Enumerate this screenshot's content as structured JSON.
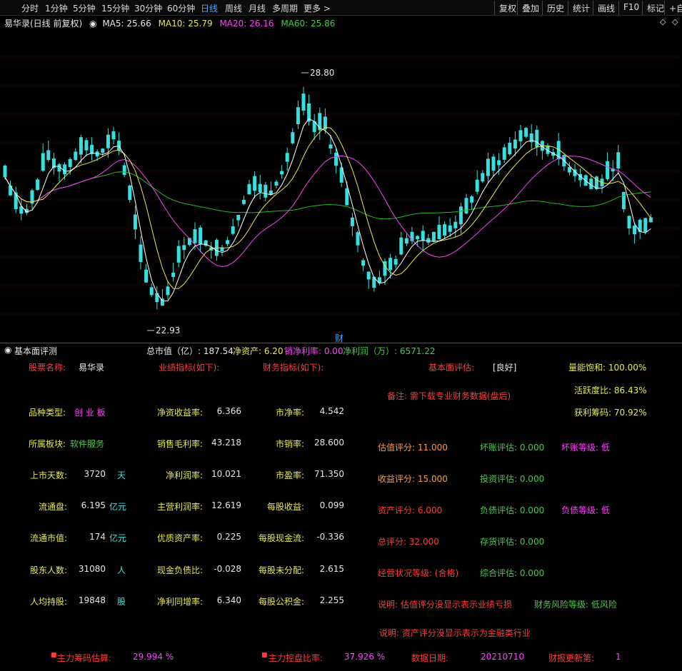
{
  "toolbar": {
    "periods": [
      "分时",
      "1分钟",
      "5分钟",
      "15分钟",
      "30分钟",
      "60分钟",
      "日线",
      "周线",
      "月线",
      "多周期",
      "更多 >"
    ],
    "active_period": "日线",
    "buttons": [
      "复权",
      "叠加",
      "历史",
      "统计",
      "画线",
      "F10",
      "标记",
      "+自"
    ]
  },
  "legend": {
    "title": "易华录(日线 前复权)",
    "ma5": "MA5: 25.66",
    "ma10": "MA10: 25.79",
    "ma20": "MA20: 26.16",
    "ma60": "MA60: 25.86"
  },
  "chart": {
    "high_label": "28.80",
    "low_label": "22.93",
    "event_marker": "财",
    "colors": {
      "up": "#ff3b3b",
      "down": "#36e0e0",
      "ma5": "#ffffff",
      "ma10": "#e8e84a",
      "ma20": "#ff40ff",
      "ma60": "#22bb22"
    }
  },
  "fundamentals_bar": {
    "title": "基本面评测",
    "market_cap": "总市值（亿）: 187.54",
    "net_assets": "净资产: 6.20",
    "net_margin": "销净利率: 0.00",
    "net_profit": "净利润（万）: 6571.22"
  },
  "panel": {
    "stock_name_label": "股票名称:",
    "stock_name": "易华录",
    "perf_header": "业绩指标(如下):",
    "fin_header": "财务指标(如下):",
    "eval_label": "基本面评估:",
    "eval_value": "[良好]",
    "volume_sat": "量能饱和: 100.00%",
    "note": "备注: 需下载专业财务数据(盘后)",
    "activity": "活跃度比: 86.43%",
    "profit_chips": "获利筹码: 70.92%",
    "left": [
      {
        "label": "品种类型:",
        "value": "创 业 板",
        "unit": ""
      },
      {
        "label": "所属板块:",
        "value": "软件服务",
        "unit": ""
      },
      {
        "label": "上市天数:",
        "value": "3720",
        "unit": "天"
      },
      {
        "label": "流通盘:",
        "value": "6.195",
        "unit": "亿元"
      },
      {
        "label": "流通市值:",
        "value": "174",
        "unit": "亿元"
      },
      {
        "label": "股东人数:",
        "value": "31080",
        "unit": "人"
      },
      {
        "label": "人均持股:",
        "value": "19848",
        "unit": "股"
      }
    ],
    "perf": [
      {
        "label": "净资收益率:",
        "value": "6.366"
      },
      {
        "label": "销售毛利率:",
        "value": "43.218"
      },
      {
        "label": "净利润率:",
        "value": "10.021"
      },
      {
        "label": "主营利润率:",
        "value": "12.619"
      },
      {
        "label": "优质资产率:",
        "value": "0.225"
      },
      {
        "label": "现金负债比:",
        "value": "-0.028"
      },
      {
        "label": "净利同增率:",
        "value": "6.340"
      }
    ],
    "fin": [
      {
        "label": "市净率:",
        "value": "4.542"
      },
      {
        "label": "市销率:",
        "value": "28.600"
      },
      {
        "label": "市盈率:",
        "value": "71.350"
      },
      {
        "label": "每股收益:",
        "value": "0.099"
      },
      {
        "label": "每股现金流:",
        "value": "-0.336"
      },
      {
        "label": "每股未分配:",
        "value": "2.615"
      },
      {
        "label": "每股公积金:",
        "value": "2.255"
      }
    ],
    "scores": {
      "valuation": "估值评分: 11.000",
      "income": "收益评分: 15.000",
      "asset": "资产评分: 6.000",
      "total": "总评分: 32.000",
      "status": "经营状况等级: (合格)",
      "bad_debt_eval": "坏账评估: 0.000",
      "invest_eval": "投资评估: 0.000",
      "liability_eval": "负债评估: 0.000",
      "inventory_eval": "存货评估: 0.000",
      "overall_eval": "综合评估: 0.000",
      "bad_debt_level": "坏账等级: 低",
      "liability_level": "负债等级: 低"
    },
    "explain1": "说明: 估值评分没显示表示业绩亏损",
    "risk_level": "财务风险等级: 低风险",
    "explain2": "说明: 资产评分没显示表示为金融类行业"
  },
  "footer": {
    "chip_label": "主力筹码估算:",
    "chip_value": "29.994 %",
    "control_label": "主力控盘比率:",
    "control_value": "37.926 %",
    "date_label": "数据日期:",
    "date_value": "20210710",
    "update_label": "财报更新第:",
    "update_value": "1"
  }
}
